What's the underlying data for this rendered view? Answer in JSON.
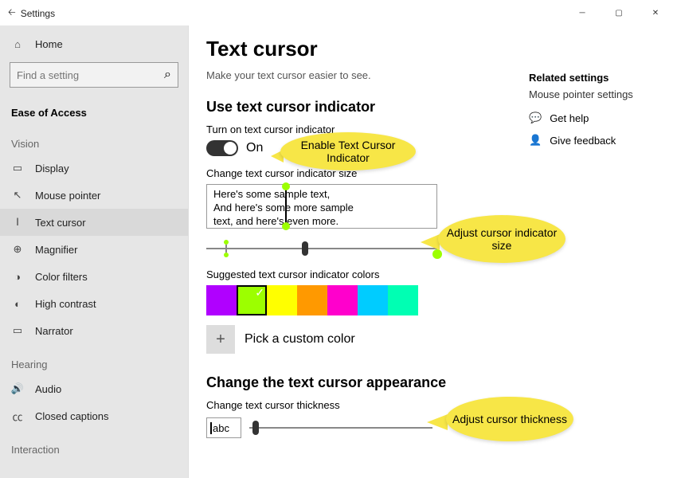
{
  "window": {
    "title": "Settings"
  },
  "sidebar": {
    "home": "Home",
    "search_placeholder": "Find a setting",
    "category": "Ease of Access",
    "groups": {
      "vision": "Vision",
      "hearing": "Hearing",
      "interaction": "Interaction"
    },
    "items": {
      "display": "Display",
      "mouse": "Mouse pointer",
      "textcursor": "Text cursor",
      "magnifier": "Magnifier",
      "colorfilters": "Color filters",
      "highcontrast": "High contrast",
      "narrator": "Narrator",
      "audio": "Audio",
      "closedcaptions": "Closed captions"
    }
  },
  "page": {
    "title": "Text cursor",
    "subtitle": "Make your text cursor easier to see.",
    "section1": "Use text cursor indicator",
    "toggle_label": "Turn on text cursor indicator",
    "toggle_state": "On",
    "size_label": "Change text cursor indicator size",
    "preview_line1": "Here's some sample text,",
    "preview_line2": "And here's some more sample",
    "preview_line3": "text, and here's even more.",
    "colors_label": "Suggested text cursor indicator colors",
    "colors": [
      "#b000ff",
      "#9cff00",
      "#ffff00",
      "#ff9900",
      "#ff00cc",
      "#00ccff",
      "#00ffb3"
    ],
    "selected_color_index": 1,
    "custom_color": "Pick a custom color",
    "section2": "Change the text cursor appearance",
    "thickness_label": "Change text cursor thickness",
    "thickness_sample": "abc"
  },
  "right": {
    "related_hd": "Related settings",
    "related_link": "Mouse pointer settings",
    "help": "Get help",
    "feedback": "Give feedback"
  },
  "callouts": {
    "c1": "Enable Text Cursor Indicator",
    "c2": "Adjust cursor indicator size",
    "c3": "Adjust cursor thickness"
  }
}
